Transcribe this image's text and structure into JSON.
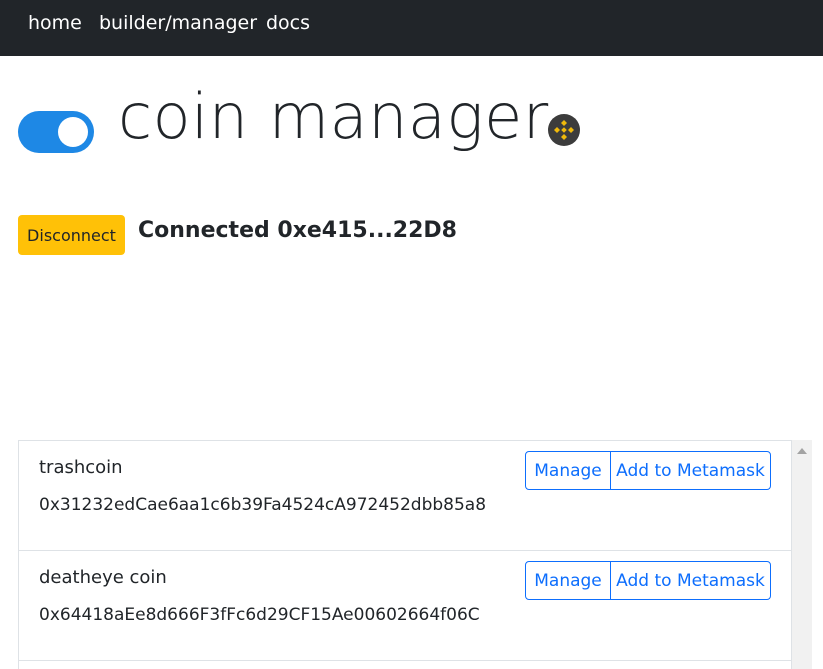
{
  "nav": {
    "items": [
      {
        "label": "home"
      },
      {
        "label": "builder/manager"
      },
      {
        "label": "docs"
      }
    ]
  },
  "header": {
    "title": "coin manager",
    "toggle_state": "on",
    "network_icon": "binance-icon"
  },
  "wallet": {
    "disconnect_label": "Disconnect",
    "status_text": "Connected 0xe415...22D8"
  },
  "coins": {
    "items": [
      {
        "name": "trashcoin",
        "address": "0x31232edCae6aa1c6b39Fa4524cA972452dbb85a8",
        "manage_label": "Manage",
        "metamask_label": "Add to Metamask"
      },
      {
        "name": "deatheye coin",
        "address": "0x64418aEe8d666F3fFc6d29CF15Ae00602664f06C",
        "manage_label": "Manage",
        "metamask_label": "Add to Metamask"
      }
    ]
  },
  "colors": {
    "navbar": "#212529",
    "toggle_accent": "#1e88e5",
    "warning": "#ffc107",
    "primary": "#0d6efd"
  }
}
